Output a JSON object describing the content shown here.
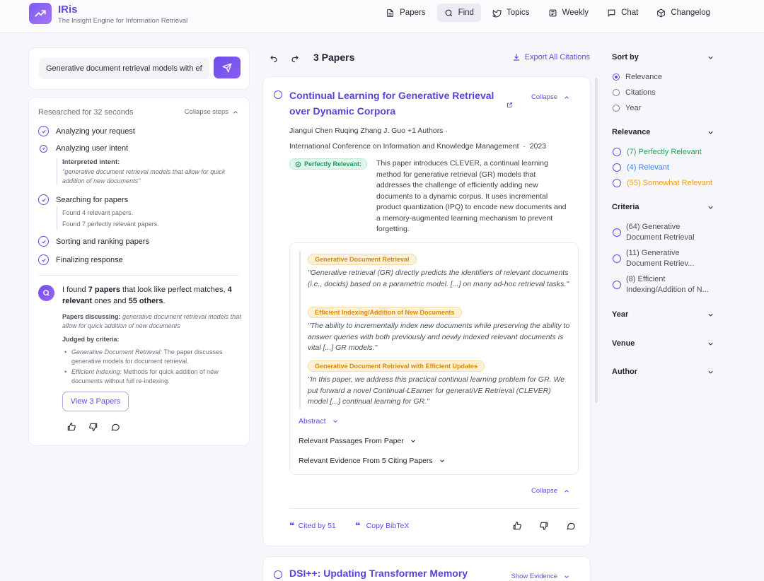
{
  "app": {
    "title": "IRis",
    "subtitle": "The Insight Engine for Information Retrieval",
    "accent_color": "#6a47e3"
  },
  "nav": [
    {
      "label": "Papers",
      "icon": "document-icon"
    },
    {
      "label": "Find",
      "icon": "search-icon",
      "active": true
    },
    {
      "label": "Topics",
      "icon": "bird-icon"
    },
    {
      "label": "Weekly",
      "icon": "newspaper-icon"
    },
    {
      "label": "Chat",
      "icon": "chat-icon"
    },
    {
      "label": "Changelog",
      "icon": "package-icon"
    }
  ],
  "search": {
    "value": "Generative document retrieval models with efficient addition of new documents"
  },
  "steps": {
    "researched": "Researched for 32 seconds",
    "collapse_label": "Collapse steps",
    "analyzing_request": "Analyzing your request",
    "analyzing_intent": "Analyzing user intent",
    "interpreted_label": "Interpreted intent:",
    "interpreted_text": "\"generative document retrieval models that allow for quick addition of new documents\"",
    "searching": "Searching for papers",
    "found_relevant": "Found 4 relevant papers.",
    "found_perfect": "Found 7 perfectly relevant papers.",
    "sorting": "Sorting and ranking papers",
    "finalizing": "Finalizing response"
  },
  "answer": {
    "intro": "I found ",
    "perfect_count": "7 papers",
    "mid": " that look like perfect matches, ",
    "relevant_count": "4 relevant",
    "mid2": " ones and ",
    "others_count": "55 others",
    "end": ".",
    "discussing_label": "Papers discussing: ",
    "discussing_text": "generative document retrieval models that allow for quick addition of new documents",
    "judged_label": "Judged by criteria:",
    "criteria": [
      {
        "name": "Generative Document Retrieval:",
        "text": " The paper discusses generative models for document retrieval."
      },
      {
        "name": "Efficient Indexing:",
        "text": " Methods for quick addition of new documents without full re-indexing."
      }
    ],
    "view_button": "View 3 Papers"
  },
  "results": {
    "count_title": "3 Papers",
    "export_label": "Export All Citations"
  },
  "paper1": {
    "title": "Continual Learning for Generative Retrieval over Dynamic Corpora",
    "collapse_label": "Collapse",
    "authors": "Jiangui Chen  Ruqing Zhang  J. Guo  +1 Authors  ·",
    "venue": "International Conference on Information and Knowledge Management",
    "year": "2023",
    "relevance_badge": "Perfectly Relevant:",
    "summary": "This paper introduces CLEVER, a continual learning method for generative retrieval (GR) models that addresses the challenge of efficiently adding new documents to a dynamic corpus. It uses incremental product quantization (IPQ) to encode new documents and a memory-augmented learning mechanism to prevent forgetting.",
    "evidence": [
      {
        "tag": "Generative Document Retrieval",
        "quote": "\"Generative retrieval (GR) directly predicts the identifiers of relevant documents (i.e., docids) based on a parametric model. [...] on many ad-hoc retrieval tasks.\""
      },
      {
        "tag": "Efficient Indexing/Addition of New Documents",
        "quote": "\"The ability to incrementally index new documents while preserving the ability to answer queries with both previously and newly indexed relevant documents is vital [...] GR models.\""
      },
      {
        "tag": "Generative Document Retrieval with Efficient Updates",
        "quote": "\"In this paper, we address this practical continual learning problem for GR. We put forward a novel Continual-LEarner for generatiVE Retrieval (CLEVER) model [...] continual learning for GR.\""
      }
    ],
    "abstract_label": "Abstract",
    "passages_label": "Relevant Passages From Paper",
    "citing_label": "Relevant Evidence From 5 Citing Papers",
    "collapse_bottom": "Collapse",
    "cited_by": "Cited by 51",
    "copy_bibtex": "Copy BibTeX"
  },
  "paper2": {
    "title": "DSI++: Updating Transformer Memory",
    "show_evidence": "Show Evidence"
  },
  "filters": {
    "sort_by": {
      "title": "Sort by",
      "options": [
        "Relevance",
        "Citations",
        "Year"
      ],
      "selected": "Relevance"
    },
    "relevance": {
      "title": "Relevance",
      "options": [
        {
          "label": "(7) Perfectly Relevant",
          "color": "#22a55b"
        },
        {
          "label": "(4) Relevant",
          "color": "#3b82f6"
        },
        {
          "label": "(55) Somewhat Relevant",
          "color": "#f59e0b"
        }
      ]
    },
    "criteria": {
      "title": "Criteria",
      "options": [
        {
          "label": "(64) Generative Document Retrieval"
        },
        {
          "label": "(11) Generative Document Retriev..."
        },
        {
          "label": "(8) Efficient Indexing/Addition of N..."
        }
      ]
    },
    "year_title": "Year",
    "venue_title": "Venue",
    "author_title": "Author"
  }
}
